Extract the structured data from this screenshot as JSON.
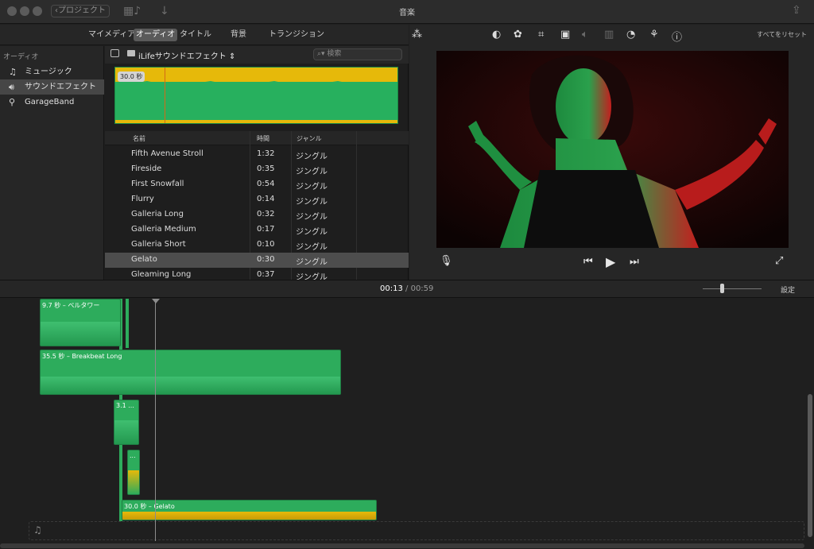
{
  "window": {
    "title": "音楽",
    "back_label": "プロジェクト"
  },
  "tabs": [
    {
      "label": "マイメディア"
    },
    {
      "label": "オーディオ",
      "selected": true
    },
    {
      "label": "タイトル"
    },
    {
      "label": "背景"
    },
    {
      "label": "トランジション"
    }
  ],
  "sidebar": {
    "heading": "オーディオ",
    "items": [
      {
        "label": "ミュージック",
        "icon": "music-note-icon"
      },
      {
        "label": "サウンドエフェクト",
        "icon": "speaker-icon",
        "selected": true
      },
      {
        "label": "GarageBand",
        "icon": "guitar-icon"
      }
    ]
  },
  "browser": {
    "source": "iLifeサウンドエフェクト",
    "search_placeholder": "検索",
    "preview_duration": "30.0 秒",
    "columns": {
      "name": "名前",
      "time": "時間",
      "genre": "ジャンル"
    },
    "rows": [
      {
        "name": "Fifth Avenue Stroll",
        "time": "1:32",
        "genre": "ジングル"
      },
      {
        "name": "Fireside",
        "time": "0:35",
        "genre": "ジングル"
      },
      {
        "name": "First Snowfall",
        "time": "0:54",
        "genre": "ジングル"
      },
      {
        "name": "Flurry",
        "time": "0:14",
        "genre": "ジングル"
      },
      {
        "name": "Galleria Long",
        "time": "0:32",
        "genre": "ジングル"
      },
      {
        "name": "Galleria Medium",
        "time": "0:17",
        "genre": "ジングル"
      },
      {
        "name": "Galleria Short",
        "time": "0:10",
        "genre": "ジングル"
      },
      {
        "name": "Gelato",
        "time": "0:30",
        "genre": "ジングル",
        "selected": true
      },
      {
        "name": "Gleaming Long",
        "time": "0:37",
        "genre": "ジングル"
      }
    ]
  },
  "viewer": {
    "reset_label": "すべてをリセット"
  },
  "timeline": {
    "current_time": "00:13",
    "separator": "/",
    "total_time": "00:59",
    "settings_label": "設定",
    "clips": [
      {
        "label": "9.7 秒 – ベルタワー"
      },
      {
        "label": "35.5 秒 – Breakbeat Long"
      },
      {
        "label": "3.1 ..."
      },
      {
        "label": "..."
      },
      {
        "label": "30.0 秒 – Gelato"
      }
    ]
  },
  "colors": {
    "clip_green": "#2dac5c",
    "peak_yellow": "#e6b90a",
    "playhead_orange": "#d36a17"
  }
}
